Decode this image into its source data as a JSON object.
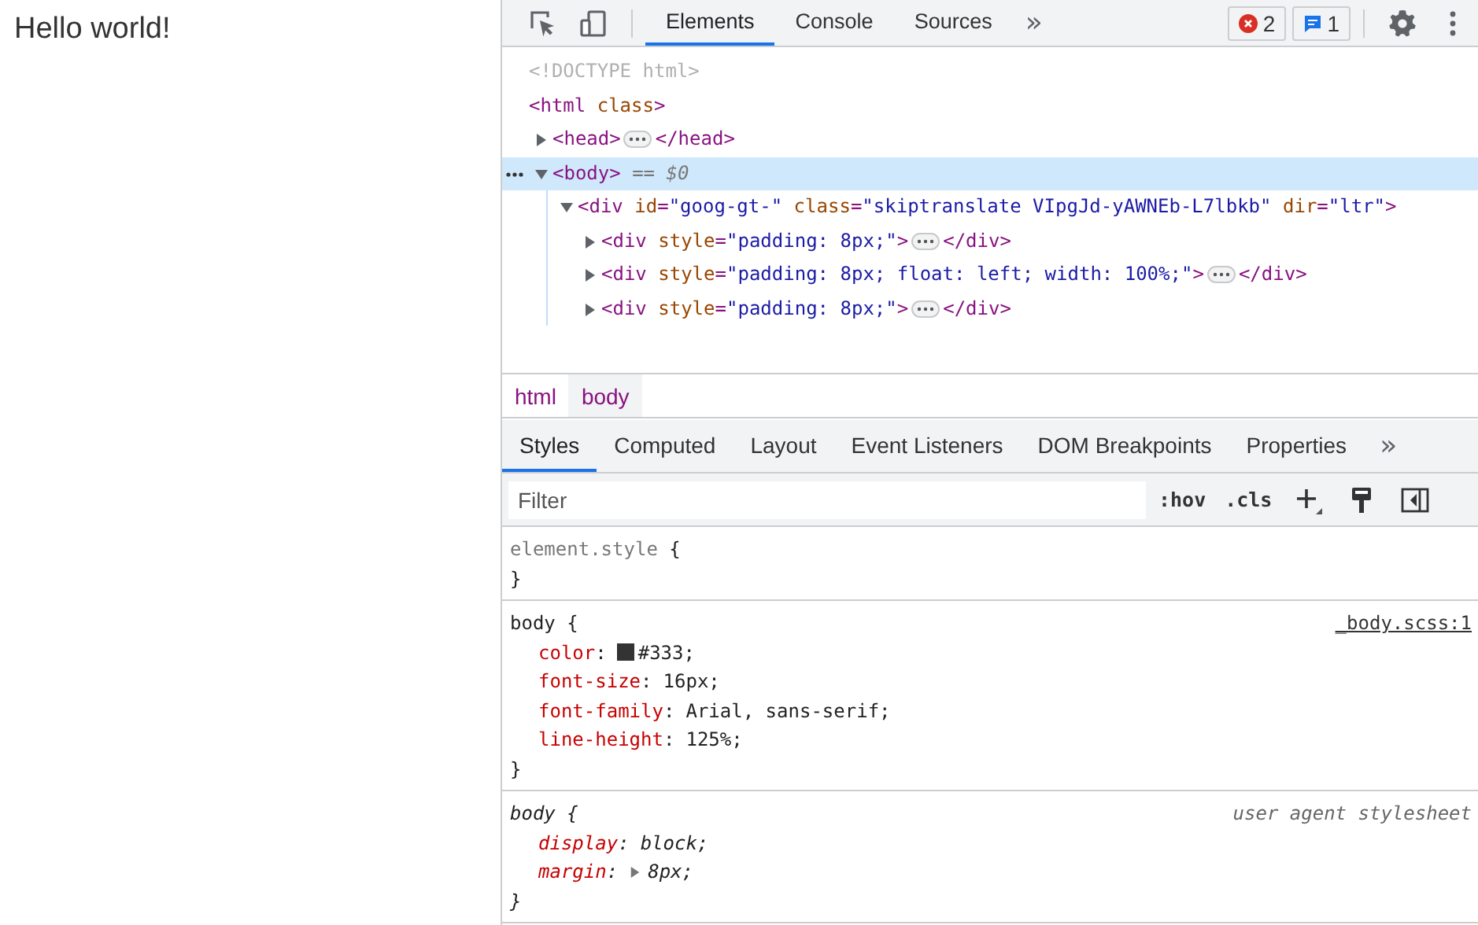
{
  "page": {
    "text": "Hello world!"
  },
  "toolbar": {
    "tabs": [
      {
        "label": "Elements",
        "selected": true
      },
      {
        "label": "Console",
        "selected": false
      },
      {
        "label": "Sources",
        "selected": false
      }
    ],
    "more": "»",
    "badges": [
      {
        "kind": "error",
        "count": "2"
      },
      {
        "kind": "message",
        "count": "1"
      }
    ]
  },
  "dom": [
    {
      "tokens": [
        {
          "kind": "doctype",
          "text": "<!DOCTYPE html>"
        }
      ],
      "selected": false
    },
    {
      "tokens": [
        {
          "kind": "tag",
          "text": "<html"
        },
        {
          "kind": "attr",
          "text": " class"
        },
        {
          "kind": "tag",
          "text": ">"
        }
      ],
      "selected": false,
      "children": [
        {
          "tokens": [
            {
              "kind": "tag",
              "text": "<head>"
            },
            {
              "kind": "ellipsis"
            },
            {
              "kind": "tag",
              "text": "</head>"
            }
          ],
          "expanded": false,
          "selected": false
        },
        {
          "tokens": [
            {
              "kind": "tag",
              "text": "<body>"
            },
            {
              "kind": "note",
              "text": " == $0"
            }
          ],
          "expanded": true,
          "selected": true,
          "children": [
            {
              "tokens": [
                {
                  "kind": "tag",
                  "text": "<div"
                },
                {
                  "kind": "attr",
                  "text": " id"
                },
                {
                  "kind": "tag",
                  "text": "="
                },
                {
                  "kind": "value",
                  "text": "\"goog-gt-\""
                },
                {
                  "kind": "attr",
                  "text": " class"
                },
                {
                  "kind": "tag",
                  "text": "="
                },
                {
                  "kind": "value",
                  "text": "\"skiptranslate VIpgJd-yAWNEb-L7lbkb\""
                },
                {
                  "kind": "attr",
                  "text": " dir"
                },
                {
                  "kind": "tag",
                  "text": "="
                },
                {
                  "kind": "value",
                  "text": "\"ltr\""
                },
                {
                  "kind": "tag",
                  "text": ">"
                }
              ],
              "expanded": true,
              "selected": false,
              "children": [
                {
                  "tokens": [
                    {
                      "kind": "tag",
                      "text": "<div"
                    },
                    {
                      "kind": "attr",
                      "text": " style"
                    },
                    {
                      "kind": "tag",
                      "text": "="
                    },
                    {
                      "kind": "value",
                      "text": "\"padding: 8px;\""
                    },
                    {
                      "kind": "tag",
                      "text": ">"
                    },
                    {
                      "kind": "ellipsis"
                    },
                    {
                      "kind": "tag",
                      "text": "</div>"
                    }
                  ],
                  "expanded": false,
                  "selected": false
                },
                {
                  "tokens": [
                    {
                      "kind": "tag",
                      "text": "<div"
                    },
                    {
                      "kind": "attr",
                      "text": " style"
                    },
                    {
                      "kind": "tag",
                      "text": "="
                    },
                    {
                      "kind": "value",
                      "text": "\"padding: 8px; float: left; width: 100%;\""
                    },
                    {
                      "kind": "tag",
                      "text": ">"
                    },
                    {
                      "kind": "ellipsis"
                    },
                    {
                      "kind": "tag",
                      "text": "</div>"
                    }
                  ],
                  "expanded": false,
                  "selected": false
                },
                {
                  "tokens": [
                    {
                      "kind": "tag",
                      "text": "<div"
                    },
                    {
                      "kind": "attr",
                      "text": " style"
                    },
                    {
                      "kind": "tag",
                      "text": "="
                    },
                    {
                      "kind": "value",
                      "text": "\"padding: 8px;\""
                    },
                    {
                      "kind": "tag",
                      "text": ">"
                    },
                    {
                      "kind": "ellipsis"
                    },
                    {
                      "kind": "tag",
                      "text": "</div>"
                    }
                  ],
                  "expanded": false,
                  "selected": false
                }
              ]
            }
          ]
        }
      ]
    }
  ],
  "breadcrumbs": [
    {
      "label": "html",
      "selected": false
    },
    {
      "label": "body",
      "selected": true
    }
  ],
  "subtabs": {
    "tabs": [
      {
        "label": "Styles",
        "selected": true
      },
      {
        "label": "Computed",
        "selected": false
      },
      {
        "label": "Layout",
        "selected": false
      },
      {
        "label": "Event Listeners",
        "selected": false
      },
      {
        "label": "DOM Breakpoints",
        "selected": false
      },
      {
        "label": "Properties",
        "selected": false
      }
    ],
    "more": "»"
  },
  "filter": {
    "placeholder": "Filter",
    "buttons": [
      ":hov",
      ".cls"
    ]
  },
  "rules": [
    {
      "kind": "inline",
      "selector": "element.style",
      "open": "{",
      "close": "}"
    },
    {
      "kind": "author",
      "selector": "body",
      "open": "{",
      "close": "}",
      "source": "_body.scss:1",
      "properties": [
        {
          "name": "color",
          "sep": ":",
          "value": "#333;",
          "color": "#333333"
        },
        {
          "name": "font-size",
          "sep": ":",
          "value": "16px;"
        },
        {
          "name": "font-family",
          "sep": ":",
          "value": "Arial, sans-serif;"
        },
        {
          "name": "line-height",
          "sep": ":",
          "value": "125%;"
        }
      ]
    },
    {
      "kind": "user-agent",
      "selector": "body",
      "open": "{",
      "close": "}",
      "source": "user agent stylesheet",
      "properties": [
        {
          "name": "display",
          "sep": ":",
          "value": "block;"
        },
        {
          "name": "margin",
          "sep": ":",
          "value": "8px;",
          "expandable": true
        }
      ]
    }
  ]
}
